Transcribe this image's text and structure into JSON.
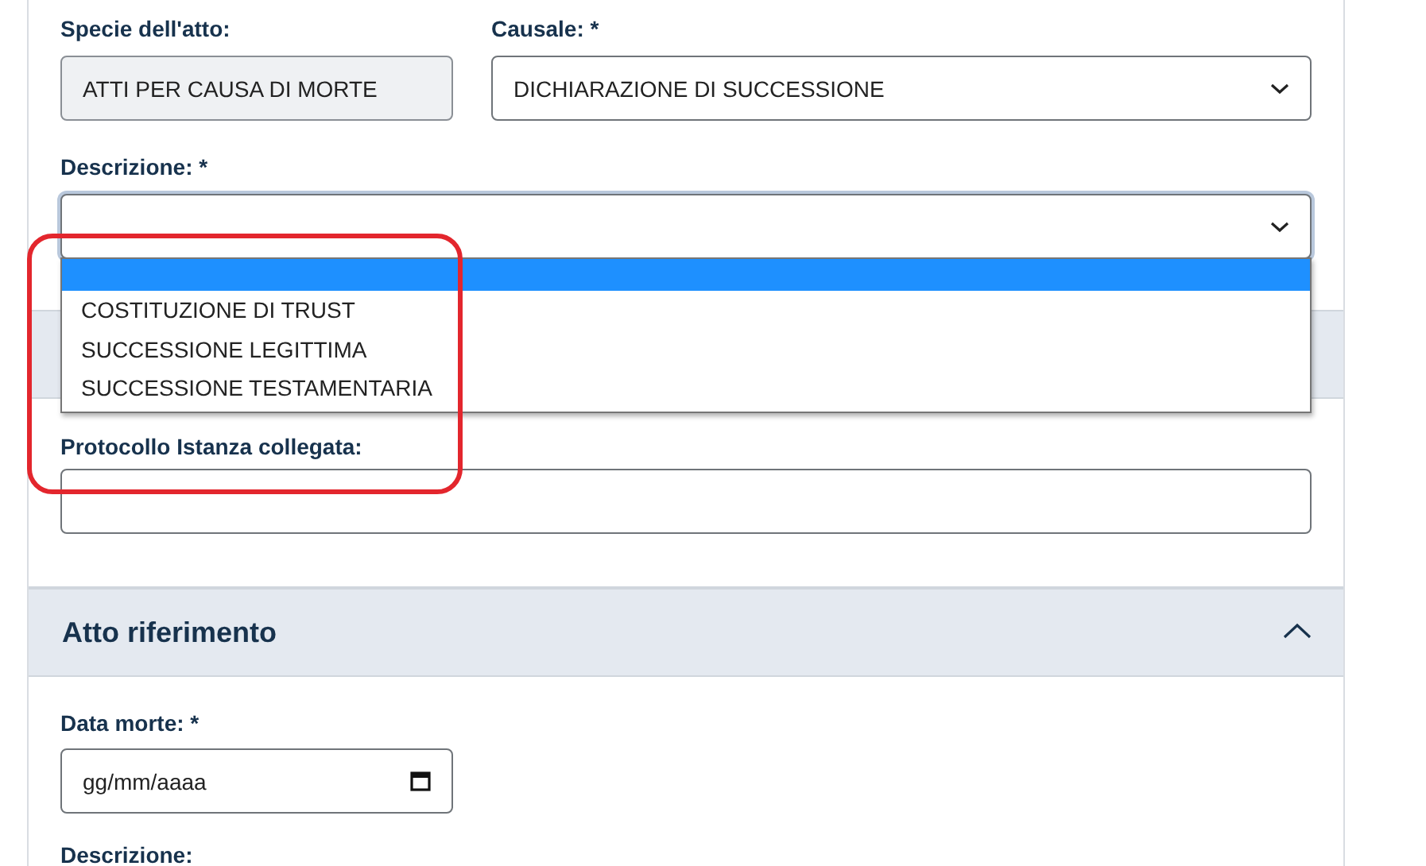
{
  "fields_row": [
    {
      "label": "Specie dell'atto:",
      "value": "ATTI PER CAUSA DI MORTE",
      "kind": "text",
      "readonly": true
    },
    {
      "label": "Causale: *",
      "value": "DICHIARAZIONE DI SUCCESSIONE",
      "kind": "select",
      "readonly": false
    }
  ],
  "descrizione": {
    "label": "Descrizione: *",
    "focused": true,
    "expanded": true,
    "options": [
      {
        "selected": true
      },
      {
        "label": "COSTITUZIONE DI TRUST",
        "selected": false
      },
      {
        "label": "SUCCESSIONE LEGITTIMA",
        "selected": false
      },
      {
        "label": "SUCCESSIONE TESTAMENTARIA",
        "selected": false
      }
    ]
  },
  "protocollo": {
    "label": "Protocollo Istanza collegata:"
  },
  "section": {
    "title": "Atto riferimento",
    "expanded": true
  },
  "data_morte": {
    "label": "Data morte: *",
    "placeholder": "gg/mm/aaaa"
  },
  "descrizione_2": {
    "label": "Descrizione:"
  }
}
